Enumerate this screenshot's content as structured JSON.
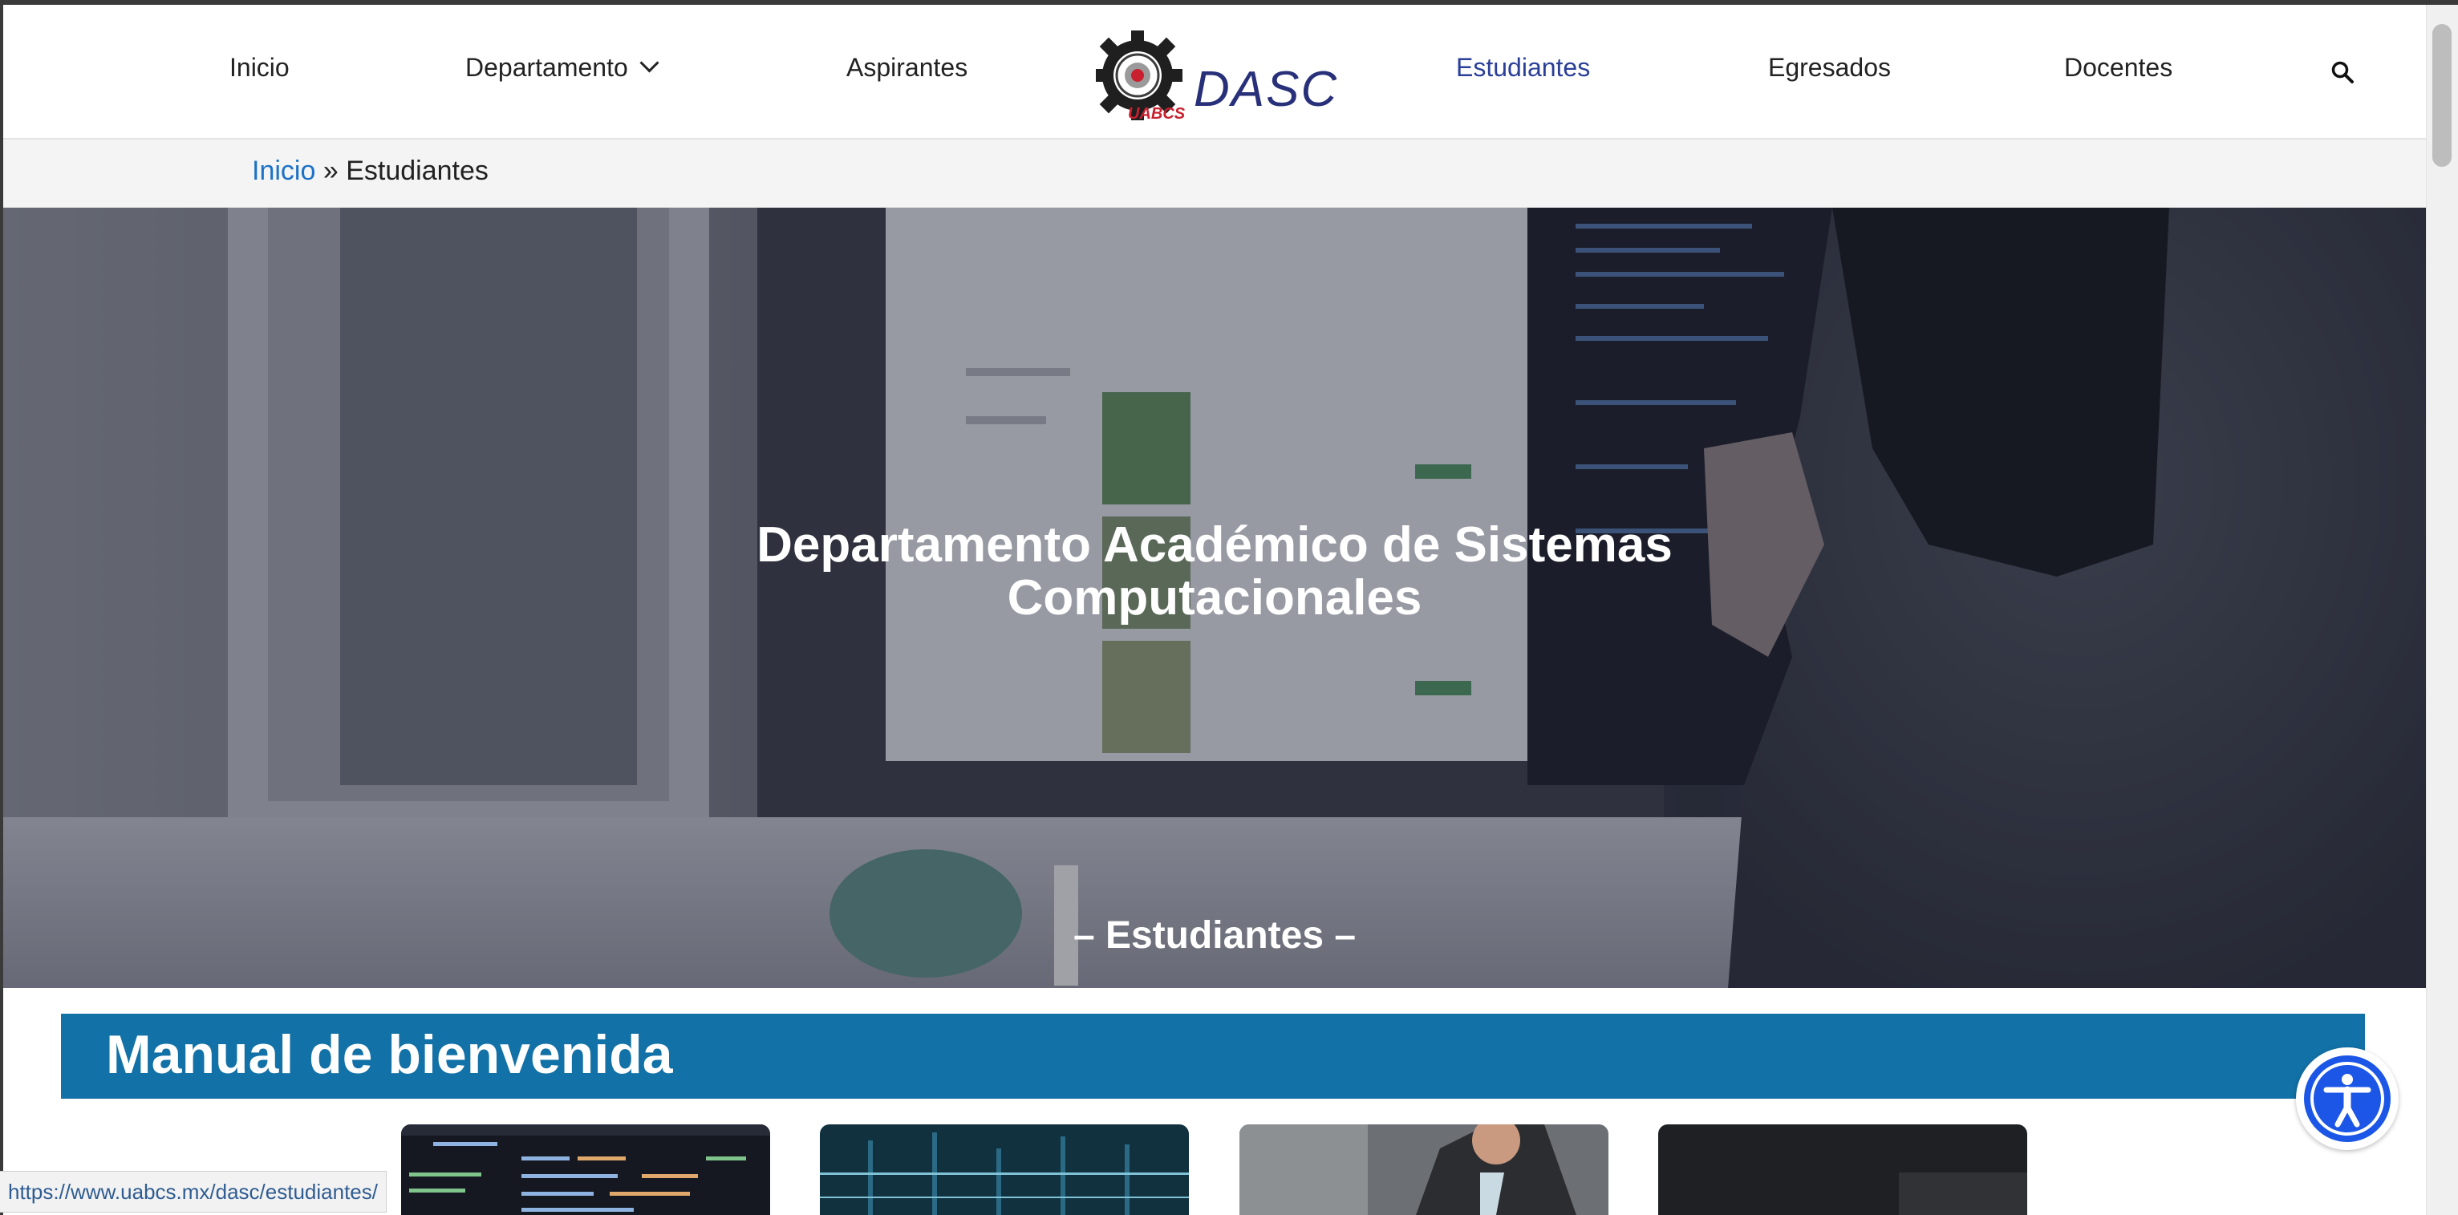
{
  "nav": {
    "items_left": [
      "Inicio",
      "Departamento",
      "Aspirantes"
    ],
    "items_right": [
      "Estudiantes",
      "Egresados",
      "Docentes"
    ],
    "active": "Estudiantes",
    "logo_text": "DASC",
    "logo_badge": "UABCS",
    "colors": {
      "active": "#2b3f98",
      "logo_blue": "#28307a",
      "logo_red": "#c8202e"
    }
  },
  "breadcrumb": {
    "home": "Inicio",
    "separator": "»",
    "current": "Estudiantes"
  },
  "hero": {
    "title_line1": "Departamento Académico de Sistemas",
    "title_line2": "Computacionales",
    "subtitle": "– Estudiantes –"
  },
  "section": {
    "title": "Manual de bienvenida",
    "color": "#1271a6"
  },
  "status": {
    "url": "https://www.uabcs.mx/dasc/estudiantes/"
  },
  "icons": [
    "chevron-down-icon",
    "search-icon",
    "accessibility-icon"
  ]
}
